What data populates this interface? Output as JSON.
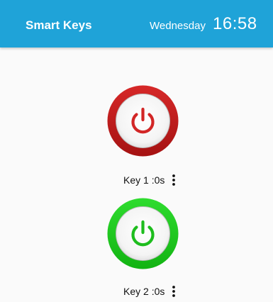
{
  "appbar": {
    "title": "Smart Keys",
    "day": "Wednesday",
    "time": "16:58",
    "color": "#1fa3d8"
  },
  "keys": [
    {
      "label": "Key 1 :0s",
      "state": "off",
      "color": "#c21d1d",
      "icon": "power-icon",
      "menu_icon": "more-vert-icon"
    },
    {
      "label": "Key 2 :0s",
      "state": "on",
      "color": "#1ec21e",
      "icon": "power-icon",
      "menu_icon": "more-vert-icon"
    }
  ]
}
